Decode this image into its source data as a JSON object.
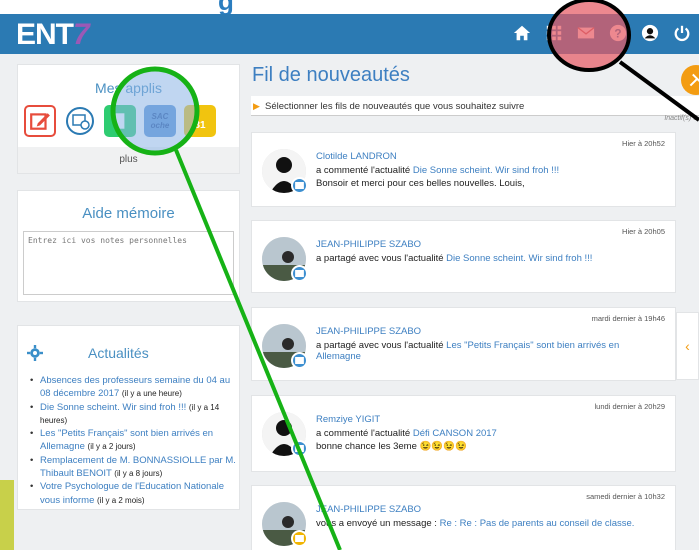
{
  "header": {
    "logo_text": "ENT",
    "logo_number": "7",
    "partial_top_text": "g",
    "icons": [
      "home-icon",
      "apps-grid-icon",
      "mail-icon",
      "help-icon",
      "user-icon",
      "power-icon"
    ]
  },
  "apps": {
    "title": "Mes applis",
    "items": [
      {
        "name": "edit-app-icon",
        "color": "#e74c3c"
      },
      {
        "name": "schedule-app-icon",
        "color": "#2b7ab3"
      },
      {
        "name": "files-app-icon",
        "color": "#27ae60"
      },
      {
        "name": "sacoche-app-icon",
        "color": "#1f5fa8",
        "label": "SAC oche"
      },
      {
        "name": "calendar-app-icon",
        "color": "#f1c40f",
        "label": "31"
      }
    ],
    "more_label": "plus"
  },
  "memo": {
    "title": "Aide mémoire",
    "placeholder": "Entrez ici vos notes personnelles"
  },
  "news": {
    "title": "Actualités",
    "items": [
      {
        "title": "Absences des professeurs semaine du 04 au 08 décembre 2017",
        "ago": "(il y a une heure)"
      },
      {
        "title": "Die Sonne scheint. Wir sind froh !!!",
        "ago": "(il y a 14 heures)"
      },
      {
        "title": "Les \"Petits Français\" sont bien arrivés en Allemagne",
        "ago": "(il y a 2 jours)"
      },
      {
        "title": "Remplacement de M. BONNASSIOLLE par M. Thibault BENOIT",
        "ago": "(il y a 8 jours)"
      },
      {
        "title": "Votre Psychologue de l'Education Nationale vous informe",
        "ago": "(il y a 2 mois)"
      }
    ]
  },
  "feed": {
    "title": "Fil de nouveautés",
    "filter_label": "Sélectionner les fils de nouveautés que vous souhaitez suivre",
    "inactive_label": "Inactif(s) 0",
    "posts": [
      {
        "time": "Hier à 20h52",
        "author": "Clotilde LANDRON",
        "action": "a commenté l'actualité",
        "link": "Die Sonne scheint. Wir sind froh !!!",
        "extra": "Bonsoir et merci pour ces belles nouvelles. Louis,"
      },
      {
        "time": "Hier à 20h05",
        "author": "JEAN-PHILIPPE SZABO",
        "action": "a partagé avec vous l'actualité",
        "link": "Die Sonne scheint. Wir sind froh !!!",
        "extra": ""
      },
      {
        "time": "mardi dernier à 19h46",
        "author": "JEAN-PHILIPPE SZABO",
        "action": "a partagé avec vous l'actualité",
        "link": "Les \"Petits Français\" sont bien arrivés en Allemagne",
        "extra": ""
      },
      {
        "time": "lundi dernier à 20h29",
        "author": "Remziye YIGIT",
        "action": "a commenté l'actualité",
        "link": "Défi CANSON 2017",
        "extra": "bonne chance les 3eme 😉😉😉😉"
      },
      {
        "time": "samedi dernier à 10h32",
        "author": "JEAN-PHILIPPE SZABO",
        "action": "vous a envoyé un message :",
        "link": "Re : Re : Pas de parents au conseil de classe.",
        "extra": ""
      }
    ]
  }
}
